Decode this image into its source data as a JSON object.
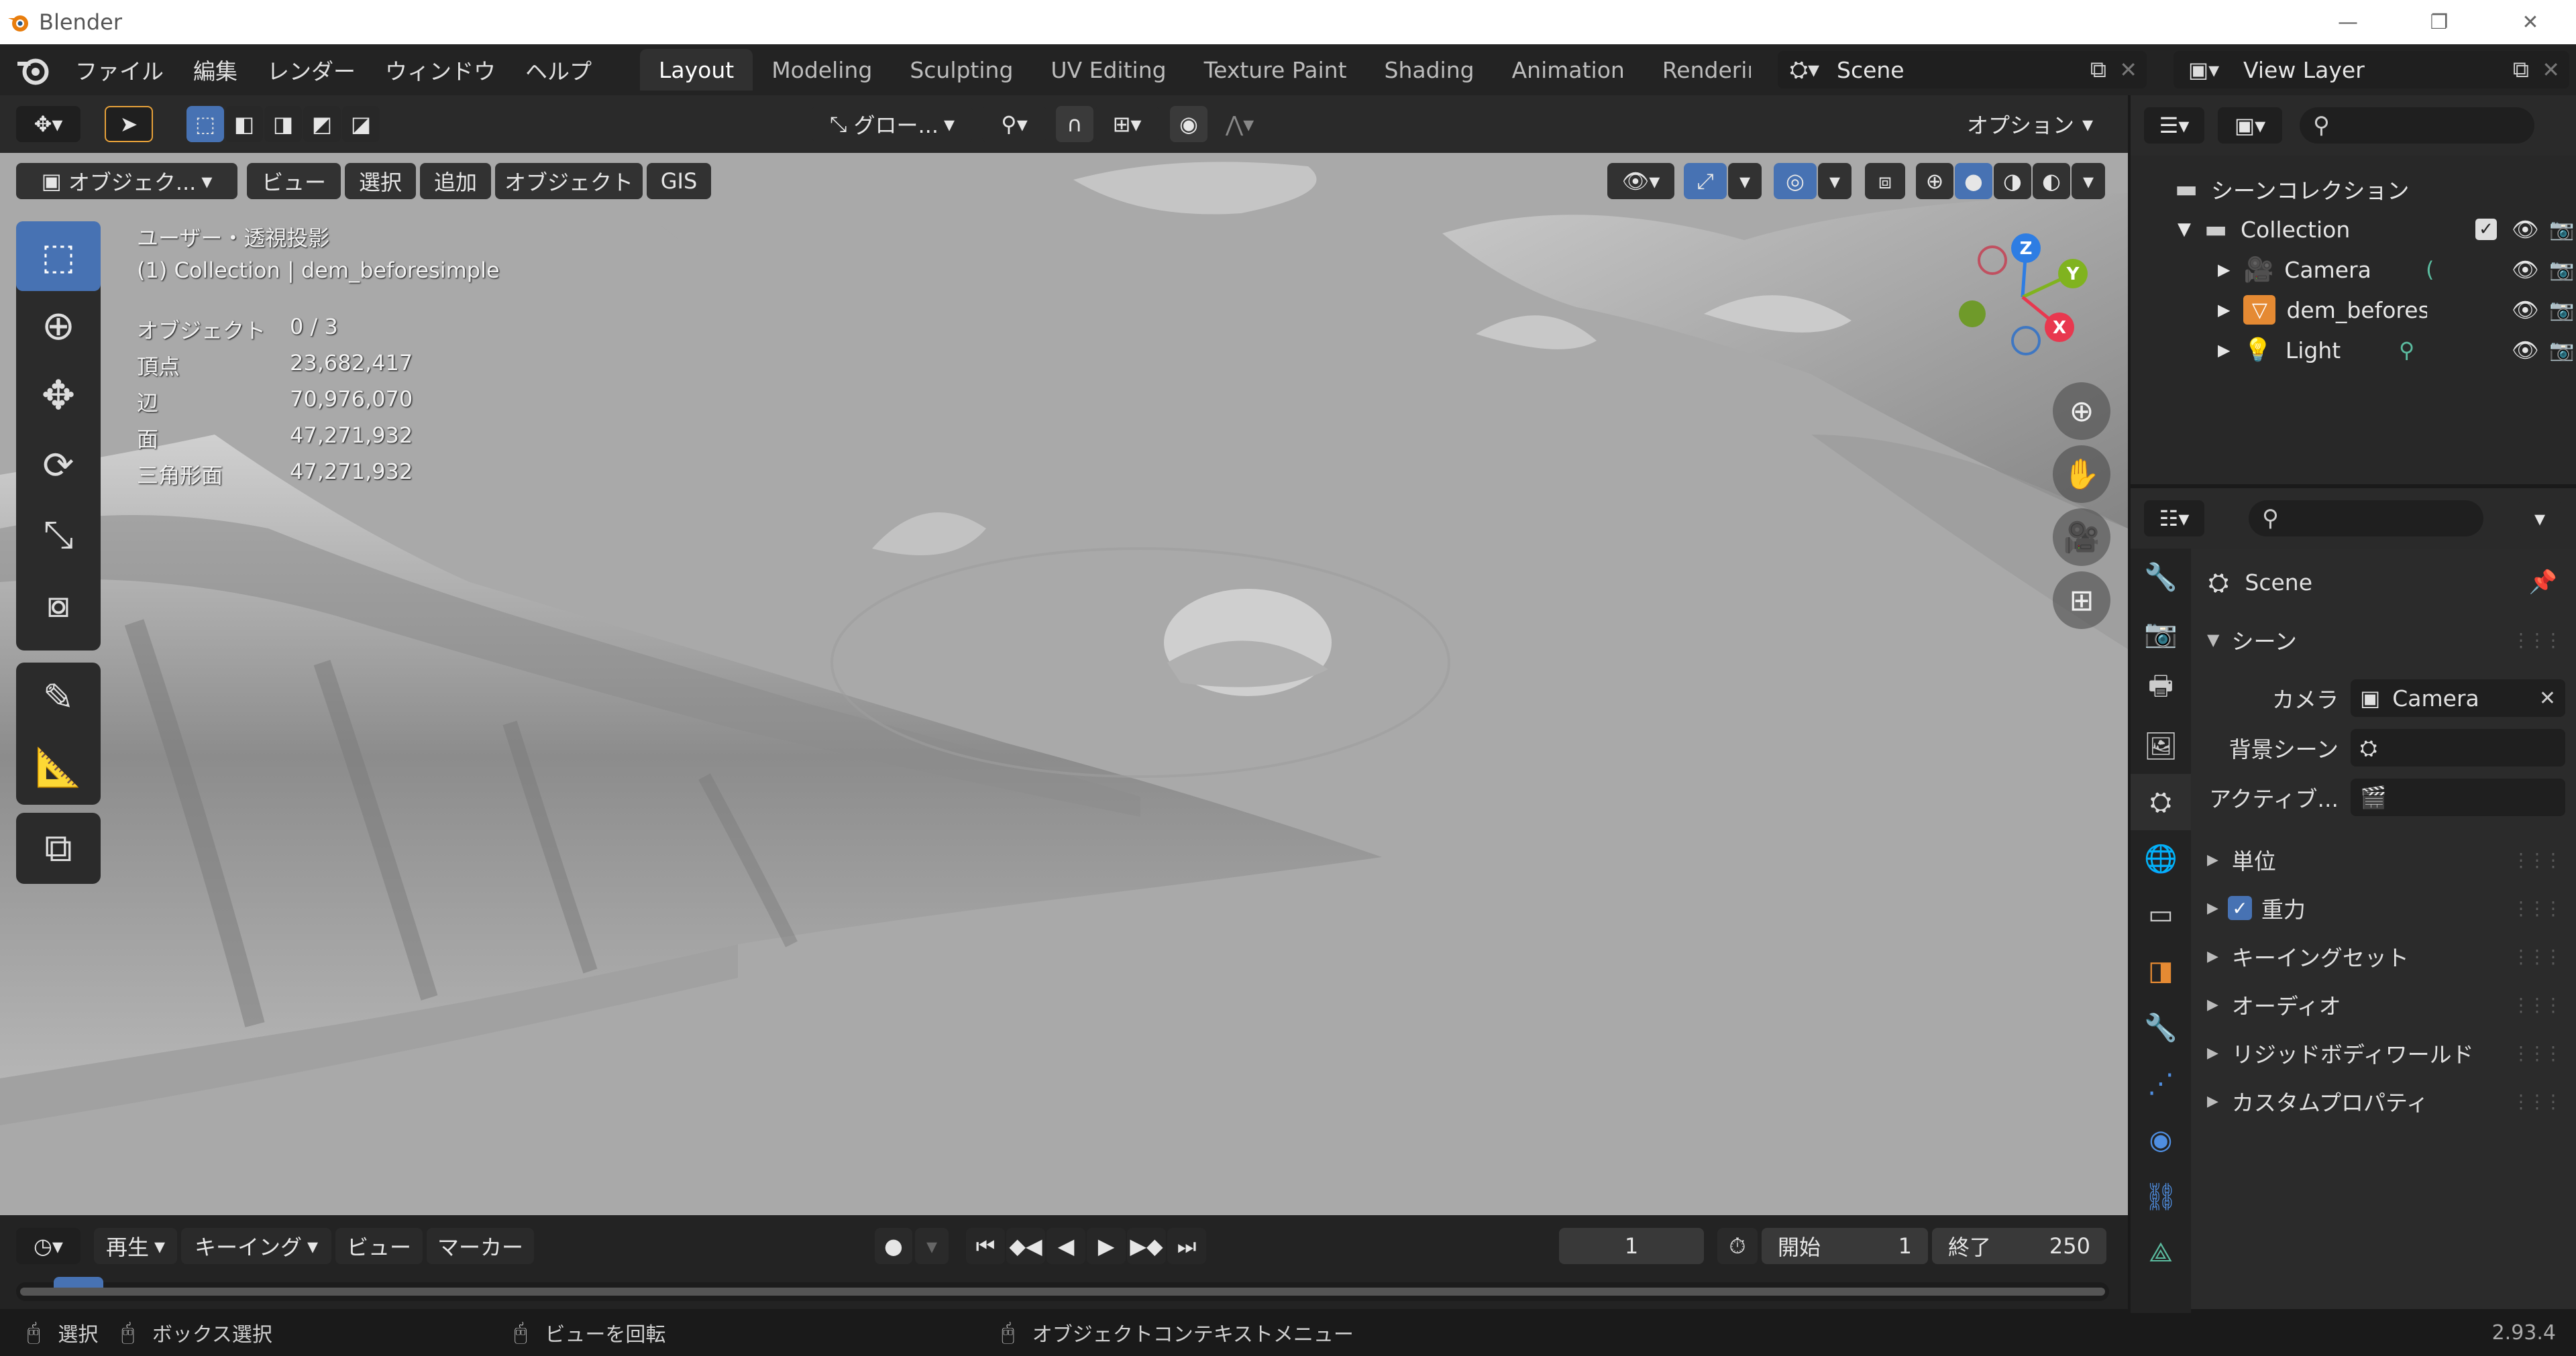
{
  "app": {
    "title": "Blender",
    "window_buttons": [
      "—",
      "❐",
      "✕"
    ],
    "version": "2.93.4"
  },
  "menu": [
    "ファイル",
    "編集",
    "レンダー",
    "ウィンドウ",
    "ヘルプ"
  ],
  "workspaces": {
    "tabs": [
      "Layout",
      "Modeling",
      "Sculpting",
      "UV Editing",
      "Texture Paint",
      "Shading",
      "Animation",
      "Rendering"
    ],
    "active": "Layout"
  },
  "scene_selector": {
    "value": "Scene"
  },
  "view_layer_selector": {
    "value": "View Layer"
  },
  "tool_header": {
    "transform_orientation": "グロー...",
    "options_label": "オプション"
  },
  "viewport_header": {
    "mode": "オブジェク...",
    "menus": [
      "ビュー",
      "選択",
      "追加",
      "オブジェクト",
      "GIS"
    ]
  },
  "viewport_overlay": {
    "view_name": "ユーザー・透視投影",
    "collection_line": "(1) Collection | dem_beforesimple",
    "stats": [
      {
        "label": "オブジェクト",
        "value": "0 / 3"
      },
      {
        "label": "頂点",
        "value": "23,682,417"
      },
      {
        "label": "辺",
        "value": "70,976,070"
      },
      {
        "label": "面",
        "value": "47,271,932"
      },
      {
        "label": "三角形面",
        "value": "47,271,932"
      }
    ]
  },
  "gizmo": {
    "axes": [
      "Z",
      "Y",
      "X"
    ]
  },
  "outliner": {
    "root": "シーンコレクション",
    "collection": "Collection",
    "items": [
      {
        "name": "Camera",
        "icon": "camera-icon"
      },
      {
        "name": "dem_befores",
        "icon": "mesh-icon"
      },
      {
        "name": "Light",
        "icon": "light-icon"
      }
    ]
  },
  "properties": {
    "context": "Scene",
    "section_scene": "シーン",
    "camera_label": "カメラ",
    "camera_value": "Camera",
    "background_label": "背景シーン",
    "active_clip_label": "アクティブ...",
    "panels": [
      {
        "label": "単位",
        "checkbox": false
      },
      {
        "label": "重力",
        "checkbox": true
      },
      {
        "label": "キーイングセット",
        "checkbox": false
      },
      {
        "label": "オーディオ",
        "checkbox": false
      },
      {
        "label": "リジッドボディワールド",
        "checkbox": false
      },
      {
        "label": "カスタムプロパティ",
        "checkbox": false
      }
    ]
  },
  "timeline": {
    "menus": [
      "再生",
      "キーイング",
      "ビュー",
      "マーカー"
    ],
    "current_frame": "1",
    "start_label": "開始",
    "start_value": "1",
    "end_label": "終了",
    "end_value": "250"
  },
  "statusbar": {
    "select": "選択",
    "box_select": "ボックス選択",
    "rotate_view": "ビューを回転",
    "context_menu": "オブジェクトコンテキストメニュー"
  },
  "colors": {
    "accent": "#4772b3",
    "axis_x": "#e8384f",
    "axis_y": "#80b31f",
    "axis_z": "#2e7de3"
  }
}
